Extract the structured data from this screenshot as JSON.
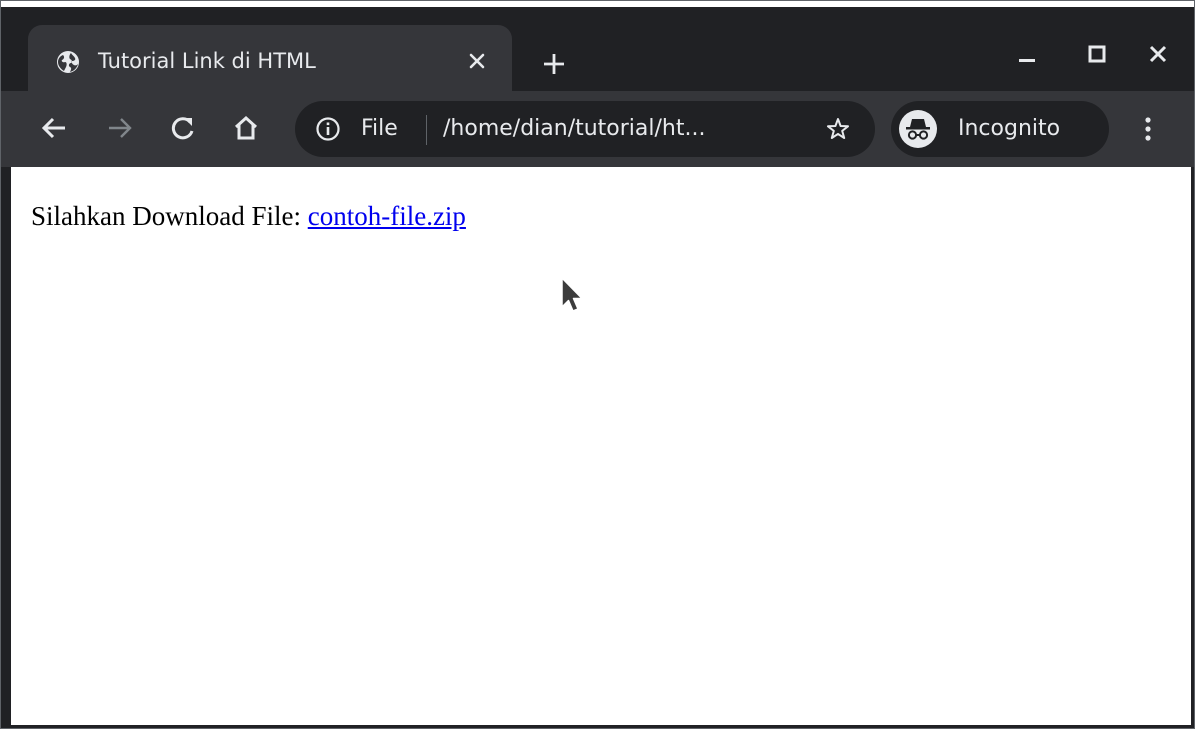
{
  "browser": {
    "tab": {
      "title": "Tutorial Link di HTML",
      "favicon": "globe-icon"
    },
    "window_controls": [
      "minimize-icon",
      "maximize-icon",
      "close-icon"
    ],
    "toolbar": {
      "omnibox": {
        "chip_label": "File",
        "url_text": "/home/dian/tutorial/ht..."
      },
      "incognito_label": "Incognito"
    }
  },
  "page": {
    "text": "Silahkan Download File:",
    "link_text": "contoh-file.zip"
  },
  "colors": {
    "tab_strip": "#202124",
    "toolbar": "#35363a",
    "link": "#0000ee",
    "ui_text": "#e8eaed"
  }
}
